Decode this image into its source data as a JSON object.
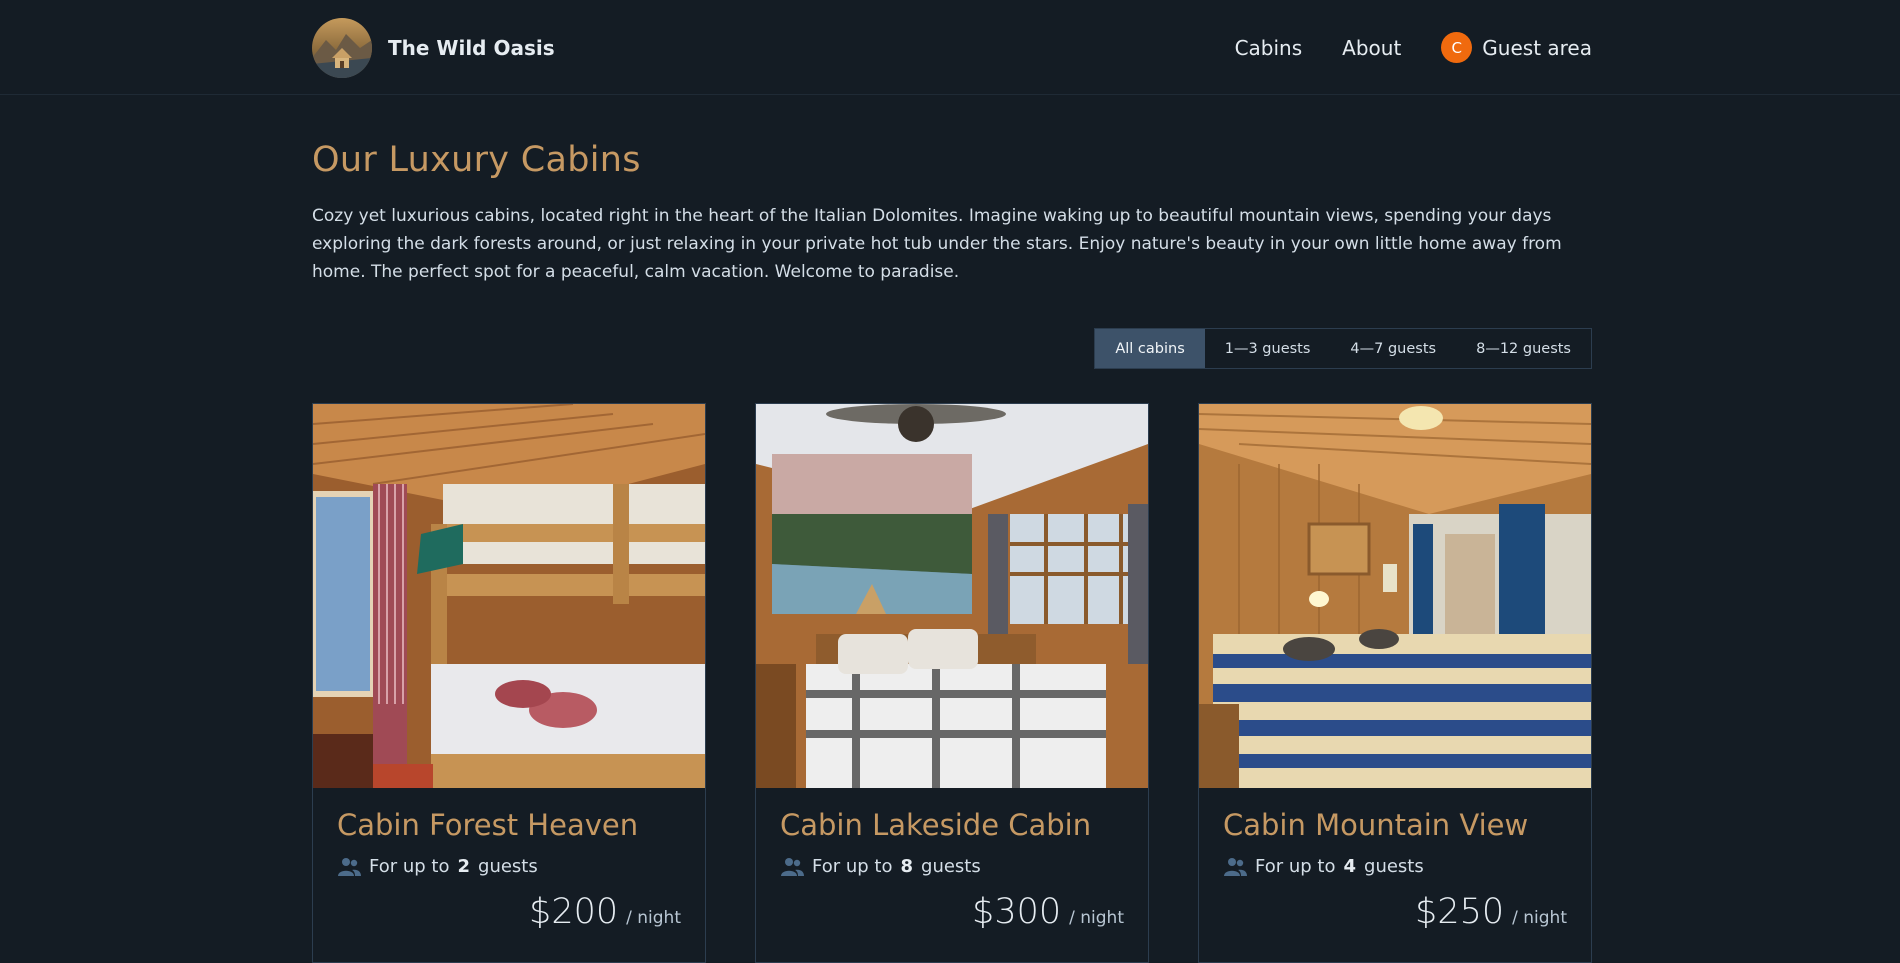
{
  "header": {
    "brand_name": "The Wild Oasis",
    "nav": {
      "cabins": "Cabins",
      "about": "About",
      "guest_area": "Guest area",
      "avatar_initial": "C"
    }
  },
  "main": {
    "title": "Our Luxury Cabins",
    "intro": "Cozy yet luxurious cabins, located right in the heart of the Italian Dolomites. Imagine waking up to beautiful mountain views, spending your days exploring the dark forests around, or just relaxing in your private hot tub under the stars. Enjoy nature's beauty in your own little home away from home. The perfect spot for a peaceful, calm vacation. Welcome to paradise.",
    "filters": [
      "All cabins",
      "1—3 guests",
      "4—7 guests",
      "8—12 guests"
    ],
    "active_filter": "All cabins",
    "cards": [
      {
        "title": "Cabin Forest Heaven",
        "capacity_prefix": "For up to",
        "capacity": "2",
        "capacity_suffix": "guests",
        "price": "$200",
        "per": "/ night"
      },
      {
        "title": "Cabin Lakeside Cabin",
        "capacity_prefix": "For up to",
        "capacity": "8",
        "capacity_suffix": "guests",
        "price": "$300",
        "per": "/ night"
      },
      {
        "title": "Cabin Mountain View",
        "capacity_prefix": "For up to",
        "capacity": "4",
        "capacity_suffix": "guests",
        "price": "$250",
        "per": "/ night"
      }
    ]
  },
  "colors": {
    "background": "#141c24",
    "accent": "#c69963",
    "avatar": "#f06a0e",
    "active_filter": "#3d5269"
  }
}
